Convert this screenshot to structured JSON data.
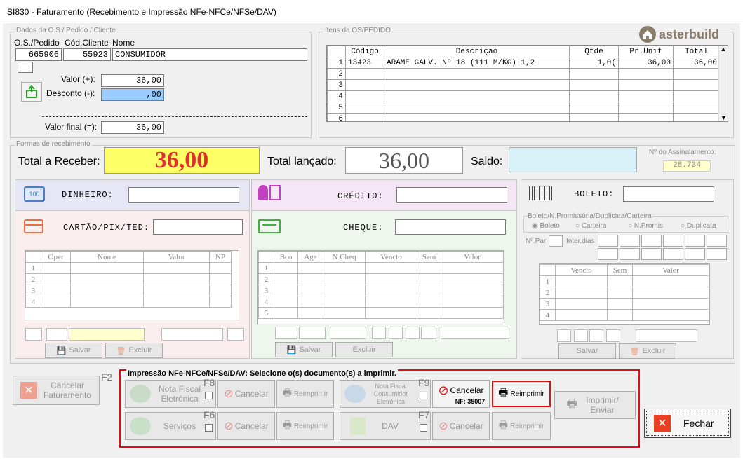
{
  "window": {
    "title": "SI830 - Faturamento (Recebimento e Impressão NFe-NFCe/NFSe/DAV)"
  },
  "brand": "asterbuild",
  "os": {
    "group_label": "Dados da O.S./ Pedido / Cliente",
    "col_os": "O.S./Pedido",
    "col_cli": "Cód.Cliente",
    "col_nome": "Nome",
    "os_value": "665906",
    "cli_value": "55923",
    "nome_value": "CONSUMIDOR",
    "valor_label": "Valor (+):",
    "valor": "36,00",
    "desconto_label": "Desconto (-):",
    "desconto": ",00",
    "final_label": "Valor final (=):",
    "final": "36,00"
  },
  "itens": {
    "group_label": "Itens da OS/PEDIDO",
    "headers": [
      "Código",
      "Descrição",
      "Qtde",
      "Pr.Unit",
      "Total"
    ],
    "rows": [
      [
        "1",
        "13423",
        "ARAME GALV. Nº 18 (111 M/KG) 1,2",
        "1,0(",
        "36,00",
        "36,00"
      ],
      [
        "2",
        "",
        "",
        "",
        "",
        ""
      ],
      [
        "3",
        "",
        "",
        "",
        "",
        ""
      ],
      [
        "4",
        "",
        "",
        "",
        "",
        ""
      ],
      [
        "5",
        "",
        "",
        "",
        "",
        ""
      ],
      [
        "6",
        "",
        "",
        "",
        "",
        ""
      ]
    ]
  },
  "receb": {
    "group_label": "Formas de recebimento",
    "total_label": "Total a Receber:",
    "total": "36,00",
    "lancado_label": "Total lançado:",
    "lancado": "36,00",
    "saldo_label": "Saldo:",
    "saldo": "",
    "assin_label": "Nº do Assinalamento:",
    "assin": "28.734"
  },
  "pay": {
    "dinheiro": "DINHEIRO:",
    "cartao": "CARTÃO/PIX/TED:",
    "credito": "CRÉDITO:",
    "cheque": "CHEQUE:",
    "boleto": "BOLETO:"
  },
  "cartao_table": {
    "headers": [
      "Oper",
      "Nome",
      "Valor",
      "NP"
    ],
    "rows": [
      "1",
      "2",
      "3",
      "4"
    ]
  },
  "cheque_table": {
    "headers": [
      "Bco",
      "Age",
      "N.Cheq",
      "Vencto",
      "Sem",
      "Valor"
    ],
    "rows": [
      "1",
      "2",
      "3",
      "4",
      "5"
    ]
  },
  "boleto": {
    "group": "Boleto/N.Promissória/Duplicata/Carteira",
    "opts": [
      "Boleto",
      "Carteira",
      "N.Promis",
      "Duplicata"
    ],
    "npar": "Nº.Par",
    "intervalo": "Inter.dias",
    "headers": [
      "Vencto",
      "Sem",
      "Valor"
    ],
    "rows": [
      "1",
      "2",
      "3",
      "4"
    ]
  },
  "actions": {
    "salvar": "Salvar",
    "excluir": "Excluir"
  },
  "imp": {
    "title": "Impressão NFe-NFCe/NFSe/DAV: Selecione o(s) documento(s) a imprimir.",
    "nf": "Nota Fiscal Eletrônica",
    "nfc": "Nota Fiscal Consumidor Eletrônica",
    "serv": "Serviços",
    "dav": "DAV",
    "cancelar": "Cancelar",
    "reimprimir": "Reimprimir",
    "nf_num": "NF: 35007",
    "f8": "F8",
    "f9": "F9",
    "f6": "F6",
    "f7": "F7",
    "imprimir": "Imprimir/ Enviar"
  },
  "cancelfat": {
    "label": "Cancelar Faturamento",
    "key": "F2"
  },
  "fechar": "Fechar",
  "colors": {
    "accent_red": "#e01010",
    "total_bg": "#ffff66",
    "total_fg": "#e03030",
    "desc_bg": "#99ccff",
    "saldo_bg": "#d8f0f8"
  }
}
